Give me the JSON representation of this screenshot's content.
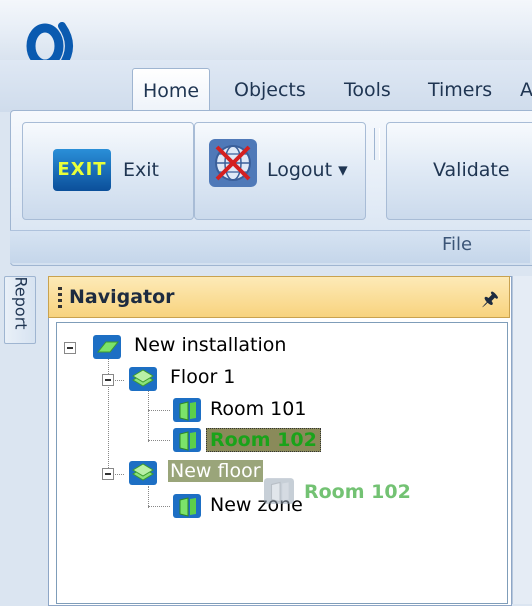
{
  "ribbon_tabs": [
    {
      "label": "Home"
    },
    {
      "label": "Objects"
    },
    {
      "label": "Tools"
    },
    {
      "label": "Timers"
    },
    {
      "label": "A"
    }
  ],
  "ribbon": {
    "exit_icon_text": "EXIT",
    "exit_label": "Exit",
    "logout_label": "Logout ▾",
    "validate_label": "Validate",
    "group_caption": "File"
  },
  "side_tab": {
    "label": "Report"
  },
  "navigator": {
    "title": "Navigator",
    "pin_glyph": "🖈",
    "tree": {
      "root": "New installation",
      "floor1": "Floor 1",
      "room101": "Room 101",
      "room102": "Room 102",
      "new_floor": "New floor",
      "new_zone": "New zone",
      "drag_ghost": "Room 102"
    }
  },
  "colors": {
    "selected_text": "#1aa31a",
    "header_gradient_top": "#fdeab7",
    "header_gradient_bottom": "#f8d37e"
  }
}
